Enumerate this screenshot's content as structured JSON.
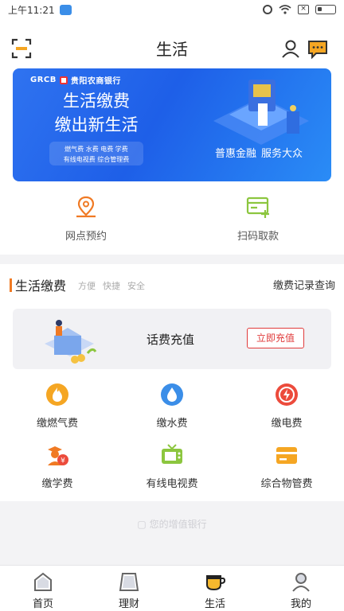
{
  "status_bar": {
    "time": "上午11:21"
  },
  "header": {
    "title": "生活"
  },
  "banner": {
    "bank_code": "GRCB",
    "bank_name": "贵阳农商银行",
    "headline_1": "生活缴费",
    "headline_2": "缴出新生活",
    "chips_line_1": "燃气费   水费   电费   学费",
    "chips_line_2": "有线电视费   综合管理费",
    "slogan_1": "普惠金融",
    "slogan_2": "服务大众"
  },
  "quick_actions": [
    {
      "label": "网点预约",
      "icon": "location-pin-icon"
    },
    {
      "label": "扫码取款",
      "icon": "card-plus-icon"
    }
  ],
  "payment_section": {
    "title": "生活缴费",
    "tags": [
      "方便",
      "快捷",
      "安全"
    ],
    "records_link": "缴费记录查询",
    "phone_topup": {
      "label": "话费充值",
      "button": "立即充值"
    },
    "services": [
      {
        "label": "缴燃气费",
        "icon": "flame-icon",
        "color": "#f5a623"
      },
      {
        "label": "缴水费",
        "icon": "water-drop-icon",
        "color": "#3b8ee8"
      },
      {
        "label": "缴电费",
        "icon": "lightning-icon",
        "color": "#ec4b3c"
      },
      {
        "label": "缴学费",
        "icon": "graduate-icon",
        "color": "#f07a24"
      },
      {
        "label": "有线电视费",
        "icon": "tv-icon",
        "color": "#8cc63f"
      },
      {
        "label": "综合物管费",
        "icon": "wallet-icon",
        "color": "#f5a623"
      }
    ]
  },
  "footer": {
    "text": "您的增值银行"
  },
  "tabbar": [
    {
      "label": "首页",
      "icon": "home-icon",
      "active": false
    },
    {
      "label": "理财",
      "icon": "finance-icon",
      "active": false
    },
    {
      "label": "生活",
      "icon": "life-cup-icon",
      "active": true
    },
    {
      "label": "我的",
      "icon": "profile-icon",
      "active": false
    }
  ],
  "colors": {
    "accent": "#f07a24",
    "banner_blue": "#1e5fe8",
    "topup_red": "#e03b3b"
  }
}
